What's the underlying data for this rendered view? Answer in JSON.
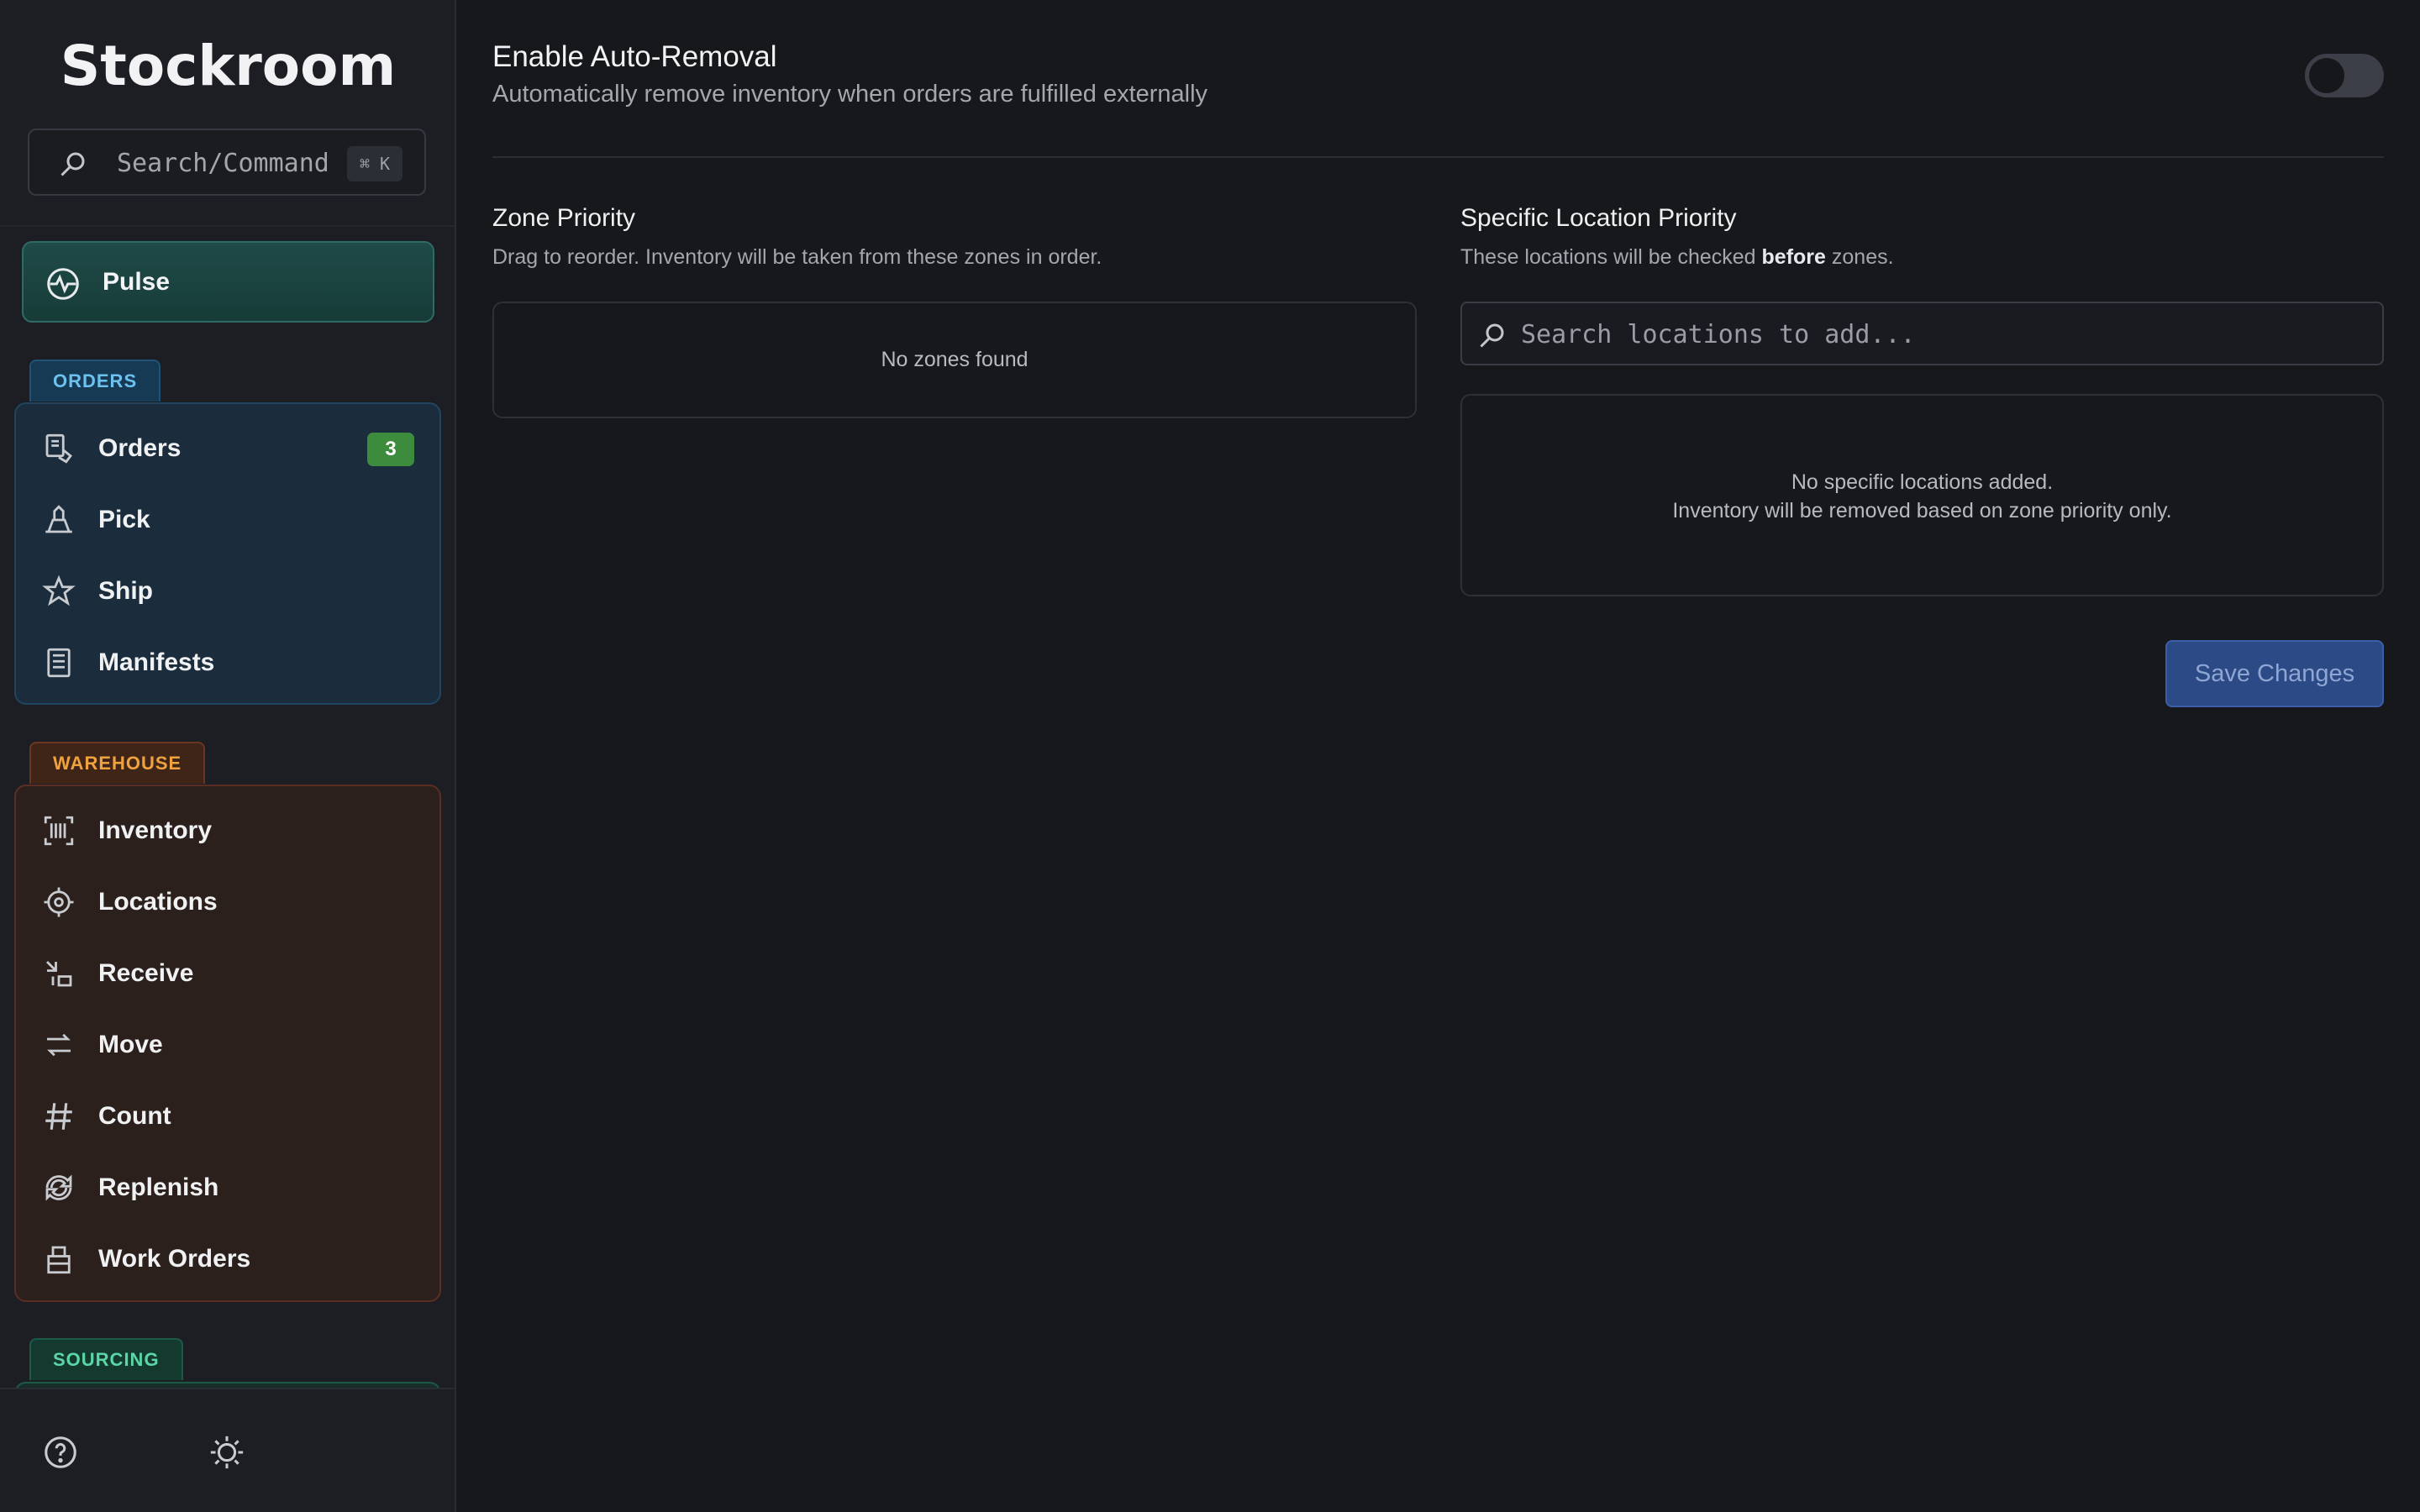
{
  "app": {
    "name": "Stockroom"
  },
  "sidebar": {
    "search": {
      "label": "Search/Command",
      "shortcut": "⌘ K",
      "icon": "search-icon"
    },
    "pulse": {
      "label": "Pulse",
      "icon": "pulse-icon"
    },
    "sections": {
      "orders": {
        "tag": "ORDERS",
        "color": "#6cc1ef",
        "items": [
          {
            "label": "Orders",
            "icon": "orders-icon",
            "badge": "3"
          },
          {
            "label": "Pick",
            "icon": "pick-icon"
          },
          {
            "label": "Ship",
            "icon": "ship-icon"
          },
          {
            "label": "Manifests",
            "icon": "manifests-icon"
          }
        ]
      },
      "warehouse": {
        "tag": "WAREHOUSE",
        "color": "#f0a23f",
        "items": [
          {
            "label": "Inventory",
            "icon": "barcode-icon"
          },
          {
            "label": "Locations",
            "icon": "crosshair-icon"
          },
          {
            "label": "Receive",
            "icon": "receive-icon"
          },
          {
            "label": "Move",
            "icon": "move-icon"
          },
          {
            "label": "Count",
            "icon": "hash-icon"
          },
          {
            "label": "Replenish",
            "icon": "replenish-icon"
          },
          {
            "label": "Work Orders",
            "icon": "work-orders-icon"
          }
        ]
      },
      "sourcing": {
        "tag": "SOURCING",
        "color": "#5bd6a6"
      }
    },
    "footer": {
      "help_icon": "help-icon",
      "theme_icon": "sun-icon"
    }
  },
  "main": {
    "auto_removal": {
      "title": "Enable Auto-Removal",
      "description": "Automatically remove inventory when orders are fulfilled externally",
      "enabled": false
    },
    "zone_priority": {
      "title": "Zone Priority",
      "description": "Drag to reorder. Inventory will be taken from these zones in order.",
      "empty_text": "No zones found"
    },
    "location_priority": {
      "title": "Specific Location Priority",
      "description_before": "These locations will be checked ",
      "description_bold": "before",
      "description_after": " zones.",
      "search_placeholder": "Search locations to add...",
      "empty_line1": "No specific locations added.",
      "empty_line2": "Inventory will be removed based on zone priority only."
    },
    "save_label": "Save Changes"
  }
}
